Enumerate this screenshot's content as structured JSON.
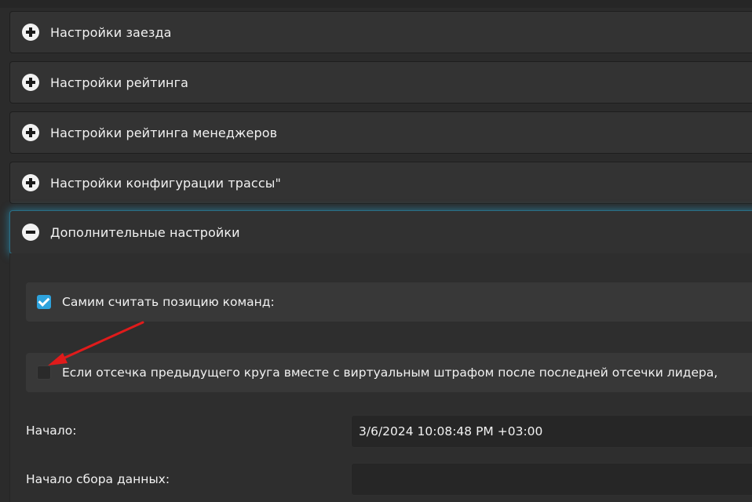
{
  "panels": [
    {
      "title": "Настройки заезда",
      "state": "collapsed"
    },
    {
      "title": "Настройки рейтинга",
      "state": "collapsed"
    },
    {
      "title": "Настройки рейтинга менеджеров",
      "state": "collapsed"
    },
    {
      "title": "Настройки конфигурации трассы\"",
      "state": "collapsed"
    },
    {
      "title": "Дополнительные настройки",
      "state": "expanded"
    }
  ],
  "options": {
    "count_team_positions": {
      "label": "Самим считать позицию команд:",
      "checked": true
    },
    "prev_lap_cutoff": {
      "label": "Если отсечка предыдущего круга вместе с виртуальным штрафом после последней отсечки лидера,",
      "checked": false
    }
  },
  "fields": {
    "start": {
      "label": "Начало:",
      "value": "3/6/2024 10:08:48 PM +03:00"
    },
    "data_collection_start": {
      "label": "Начало сбора данных:",
      "value": ""
    }
  },
  "colors": {
    "background": "#2b2b2b",
    "panel": "#333333",
    "accent_glow": "#2896be",
    "checkbox_checked": "#2ea3dd",
    "annotation_arrow": "#e01b1b"
  },
  "icons": {
    "collapsed": "plus-circle-icon",
    "expanded": "minus-circle-icon",
    "annotation": "red-arrow-icon"
  }
}
